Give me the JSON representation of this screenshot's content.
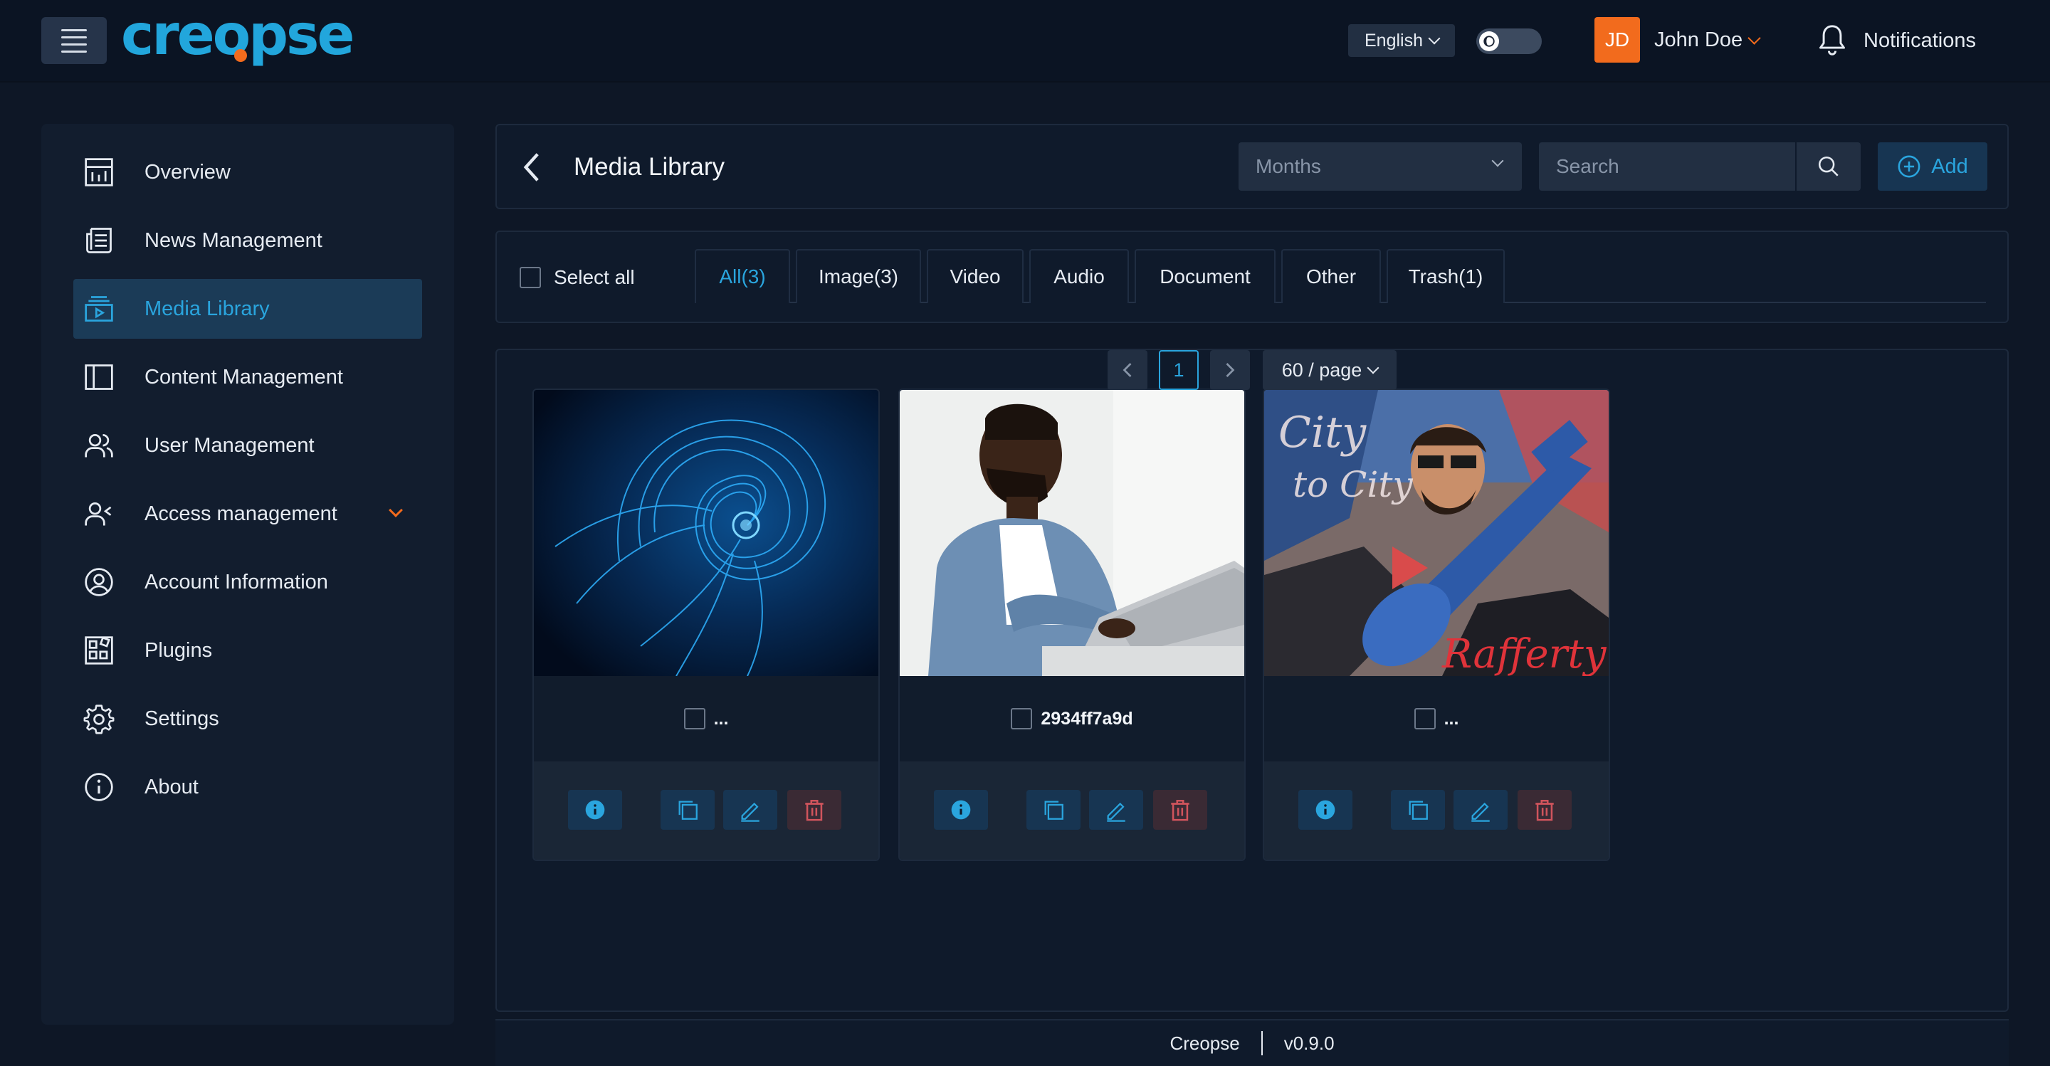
{
  "header": {
    "logo": "creopse",
    "language": "English",
    "user_initials": "JD",
    "user_name": "John Doe",
    "notifications_label": "Notifications"
  },
  "sidebar": {
    "items": [
      {
        "label": "Overview",
        "icon": "dashboard-chart-icon"
      },
      {
        "label": "News Management",
        "icon": "newspaper-icon"
      },
      {
        "label": "Media Library",
        "icon": "media-folder-icon",
        "active": true
      },
      {
        "label": "Content Management",
        "icon": "layout-panel-icon"
      },
      {
        "label": "User Management",
        "icon": "users-icon"
      },
      {
        "label": "Access management",
        "icon": "user-access-icon",
        "expandable": true
      },
      {
        "label": "Account Information",
        "icon": "user-circle-icon"
      },
      {
        "label": "Plugins",
        "icon": "plugins-grid-icon"
      },
      {
        "label": "Settings",
        "icon": "gear-icon"
      },
      {
        "label": "About",
        "icon": "info-circle-icon"
      }
    ]
  },
  "main": {
    "title": "Media Library",
    "months_placeholder": "Months",
    "search_placeholder": "Search",
    "add_label": "Add",
    "select_all_label": "Select all",
    "tabs": [
      {
        "label": "All(3)",
        "active": true
      },
      {
        "label": "Image(3)"
      },
      {
        "label": "Video"
      },
      {
        "label": "Audio"
      },
      {
        "label": "Document"
      },
      {
        "label": "Other"
      },
      {
        "label": "Trash(1)"
      }
    ],
    "media": [
      {
        "name": "...",
        "image": "blue-fractal-swirl"
      },
      {
        "name": "2934ff7a9d",
        "image": "man-working-on-laptop"
      },
      {
        "name": "...",
        "image": "city-to-city-album-cover"
      }
    ],
    "pagination": {
      "current_page": "1",
      "page_size": "60 / page"
    }
  },
  "footer": {
    "brand": "Creopse",
    "version": "v0.9.0"
  },
  "colors": {
    "background": "#0e1726",
    "panel": "#0f1a2b",
    "accent": "#2aa5de",
    "brand_orange": "#f26b1d",
    "active_nav": "#1b3b57",
    "delete": "#d0545c"
  }
}
